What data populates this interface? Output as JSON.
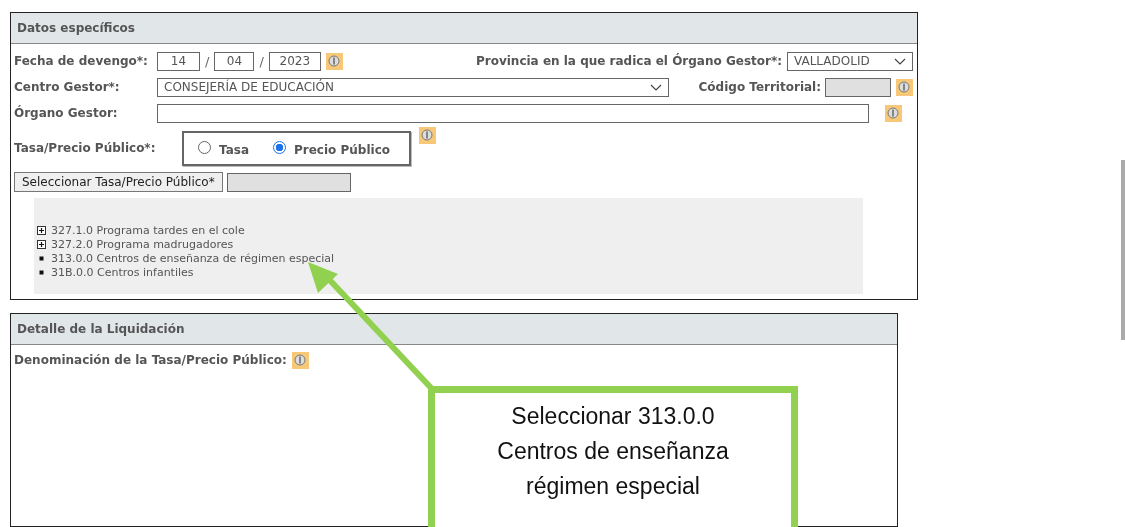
{
  "datos_especificos": {
    "title": "Datos específicos",
    "fecha": {
      "label": "Fecha de devengo*:",
      "day": "14",
      "month": "04",
      "year": "2023",
      "separator": "/"
    },
    "provincia": {
      "label": "Provincia en la que radica el Órgano Gestor*:",
      "value": "VALLADOLID"
    },
    "centro_gestor": {
      "label": "Centro Gestor*:",
      "value": "CONSEJERÍA DE EDUCACIÓN"
    },
    "codigo_territorial": {
      "label": "Código Territorial:"
    },
    "organo_gestor": {
      "label": "Órgano Gestor:"
    },
    "tasa_precio": {
      "label": "Tasa/Precio Público*:",
      "options": [
        {
          "label": "Tasa",
          "selected": false
        },
        {
          "label": "Precio Público",
          "selected": true
        }
      ]
    },
    "select_button": "Seleccionar Tasa/Precio Público*",
    "tree": [
      {
        "kind": "expandable",
        "label": "327.1.0 Programa tardes en el cole"
      },
      {
        "kind": "expandable",
        "label": "327.2.0 Programa madrugadores"
      },
      {
        "kind": "leaf",
        "label": "313.0.0 Centros de enseñanza de régimen especial"
      },
      {
        "kind": "leaf",
        "label": "31B.0.0 Centros infantiles"
      }
    ]
  },
  "detalle": {
    "title": "Detalle de la Liquidación",
    "denominacion_label": "Denominación de la Tasa/Precio Público:"
  },
  "callout": {
    "lines": [
      "Seleccionar 313.0.0",
      "Centros de enseñanza",
      "régimen especial"
    ]
  }
}
